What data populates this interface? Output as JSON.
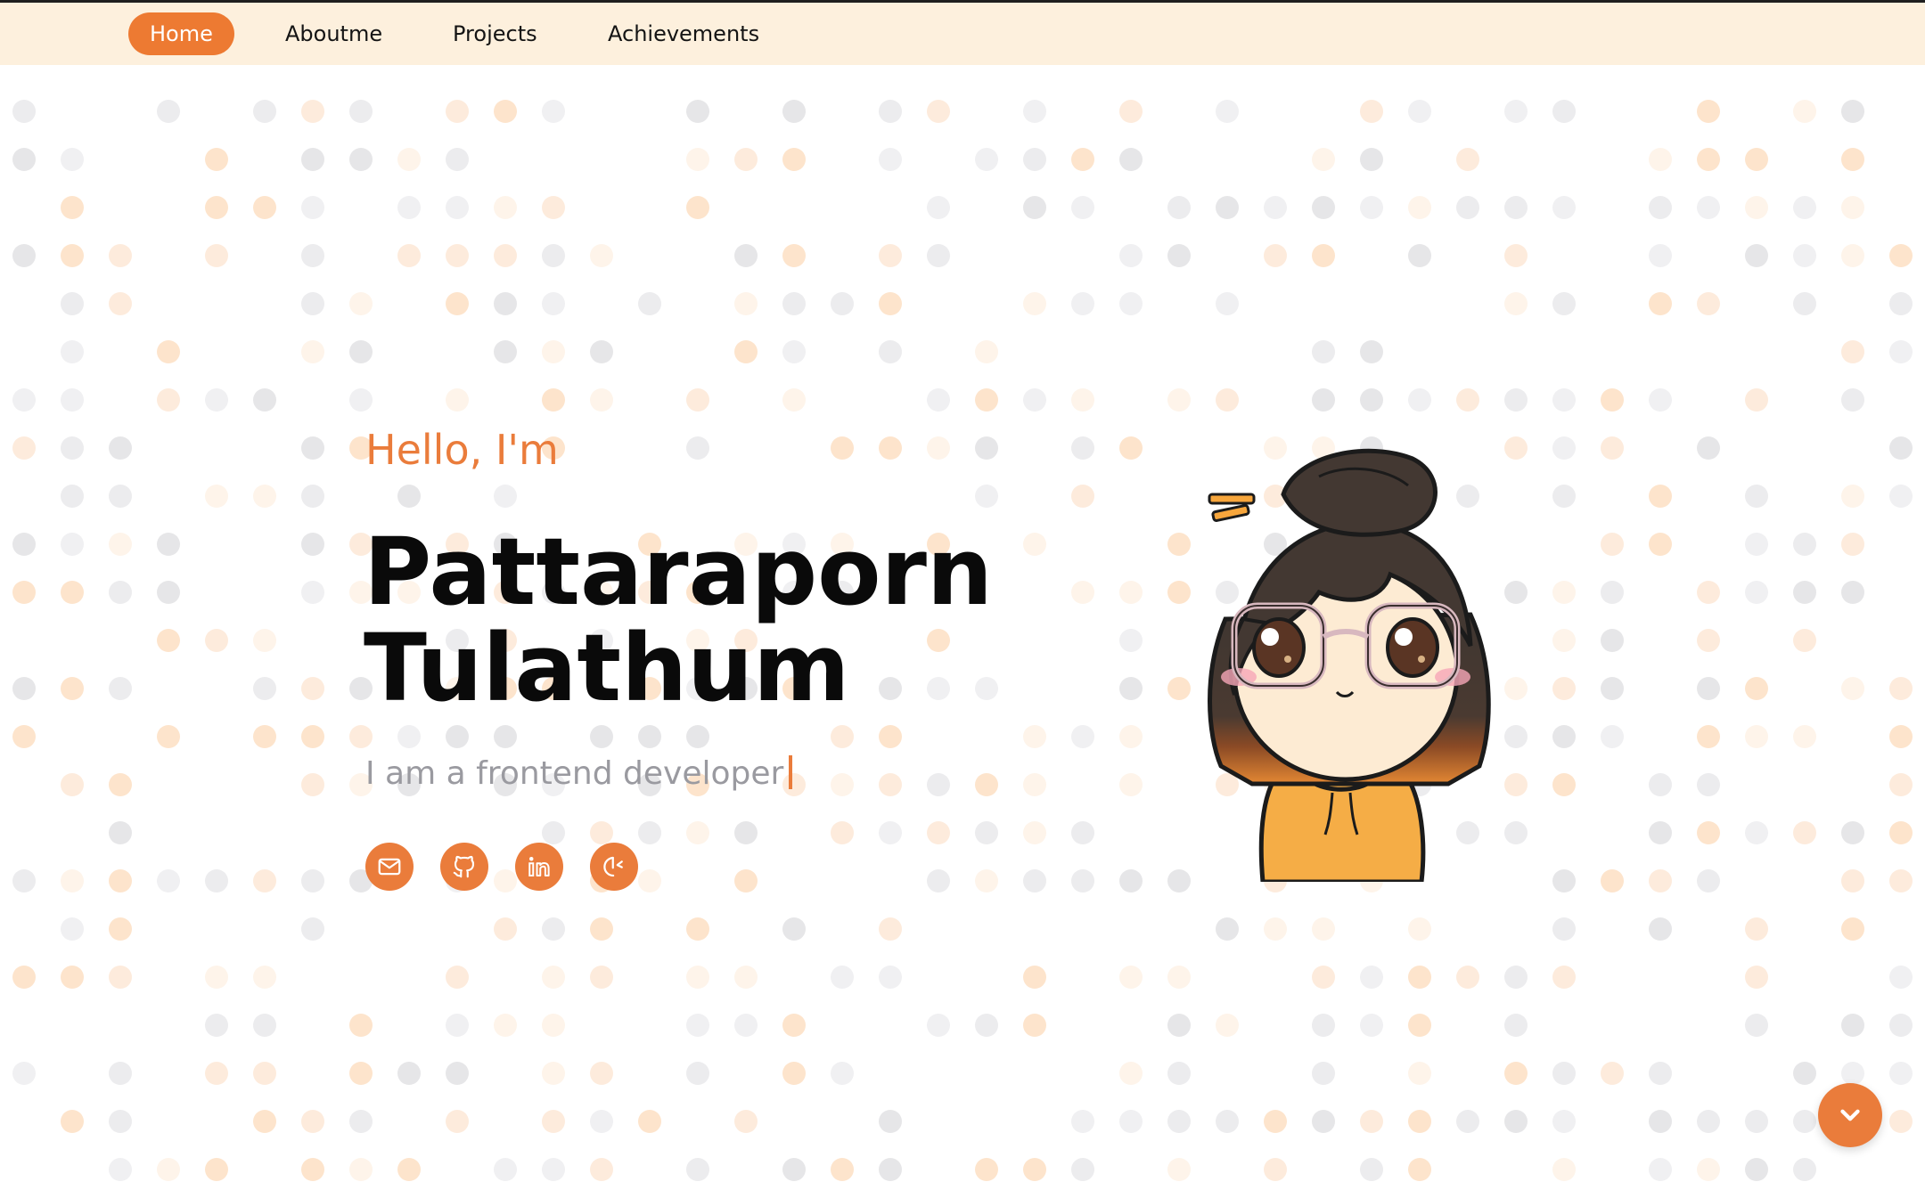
{
  "nav": {
    "items": [
      {
        "label": "Home",
        "active": true
      },
      {
        "label": "Aboutme",
        "active": false
      },
      {
        "label": "Projects",
        "active": false
      },
      {
        "label": "Achievements",
        "active": false
      }
    ]
  },
  "hero": {
    "greeting": "Hello, I'm",
    "first_name": "Pattaraporn",
    "last_name": "Tulathum",
    "tagline": "I am a frontend developer"
  },
  "social_icons": [
    "mail-icon",
    "github-icon",
    "linkedin-icon",
    "medium-icon"
  ],
  "scroll_icon": "chevron-down-icon",
  "colors": {
    "accent": "#ea7c3b",
    "nav_background": "#fdf0dd",
    "dot_orange": "#fde6d2",
    "dot_gray": "#eeeeee"
  }
}
